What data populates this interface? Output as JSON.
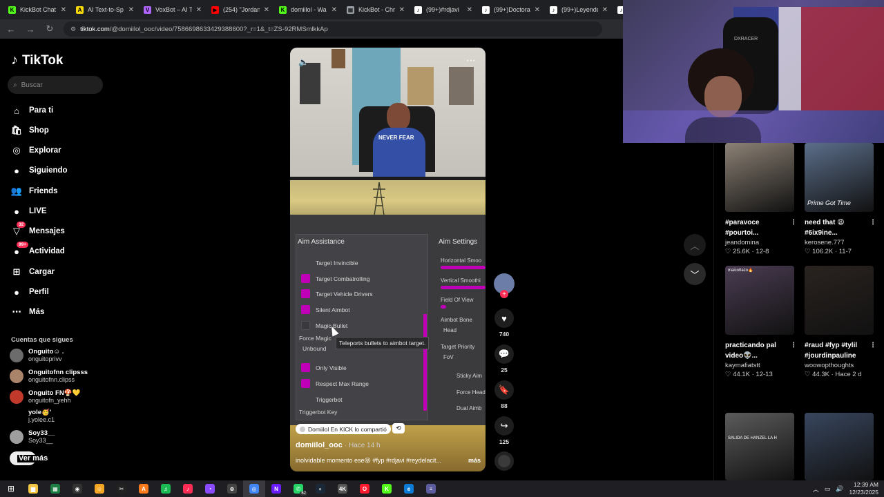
{
  "browser": {
    "tabs": [
      {
        "label": "KickBot Chat",
        "fav_color": "#53fc18",
        "fav_char": "K"
      },
      {
        "label": "AI Text-to-Sp",
        "fav_color": "#f5d90a",
        "fav_char": "A"
      },
      {
        "label": "VoxBot – AI T",
        "fav_color": "#b065ff",
        "fav_char": "V"
      },
      {
        "label": "(254) \"Jordan",
        "fav_color": "#ff0000",
        "fav_char": "▶"
      },
      {
        "label": "domiilol - Wa",
        "fav_color": "#53fc18",
        "fav_char": "K"
      },
      {
        "label": "KickBot - Chr",
        "fav_color": "#9aa0a6",
        "fav_char": "▦"
      },
      {
        "label": "(99+)#rdjavi",
        "fav_color": "#ffffff",
        "fav_char": "♪"
      },
      {
        "label": "(99+)Doctora",
        "fav_color": "#ffffff",
        "fav_char": "♪"
      },
      {
        "label": "(99+)Leyende",
        "fav_color": "#ffffff",
        "fav_char": "♪"
      },
      {
        "label": "(9",
        "fav_color": "#ffffff",
        "fav_char": "♪"
      }
    ],
    "url_domain": "tiktok.com",
    "url_path": "/@domiilol_ooc/video/7586698633429388600?_r=1&_t=ZS-92RMSmlkkAp"
  },
  "sidebar": {
    "logo": "TikTok",
    "search_placeholder": "Buscar",
    "nav": [
      {
        "label": "Para ti",
        "icon": "home-icon"
      },
      {
        "label": "Shop",
        "icon": "shop-icon"
      },
      {
        "label": "Explorar",
        "icon": "compass-icon"
      },
      {
        "label": "Siguiendo",
        "icon": "following-icon"
      },
      {
        "label": "Friends",
        "icon": "friends-icon"
      },
      {
        "label": "LIVE",
        "icon": "live-icon"
      },
      {
        "label": "Mensajes",
        "icon": "messages-icon",
        "badge": "32"
      },
      {
        "label": "Actividad",
        "icon": "activity-icon",
        "badge": "99+"
      },
      {
        "label": "Cargar",
        "icon": "upload-icon"
      },
      {
        "label": "Perfil",
        "icon": "profile-icon"
      },
      {
        "label": "Más",
        "icon": "more-icon"
      }
    ],
    "following_title": "Cuentas que sigues",
    "following": [
      {
        "name": "Onguito☺ .",
        "user": "onguitoprivv",
        "color": "#6c6c6c"
      },
      {
        "name": "Onguitofnn clipsss",
        "user": "onguitofnn.clipss",
        "color": "#a9846a"
      },
      {
        "name": "Onguito FN🍄💛",
        "user": "onguitofn_yehh",
        "color": "#c0392b"
      },
      {
        "name": "yole🥳'",
        "user": "j.yolee.c1",
        "color": "#000000"
      },
      {
        "name": "Soy33__",
        "user": "Soy33__",
        "color": "#9e9e9e"
      }
    ],
    "see_more": "Ver más"
  },
  "video": {
    "shirt_text": "NEVER FEAR",
    "menu": {
      "left_title": "Aim Assistance",
      "right_title": "Aim Settings",
      "options": [
        {
          "label": "Target Invincible",
          "checked": false,
          "hidden_box": true
        },
        {
          "label": "Target Combatrolling",
          "checked": true
        },
        {
          "label": "Target Vehicle Drivers",
          "checked": true
        },
        {
          "label": "Silent Aimbot",
          "checked": true
        },
        {
          "label": "Magic Bullet",
          "checked": false
        },
        {
          "label": "Only Visible",
          "checked": true
        },
        {
          "label": "Respect Max Range",
          "checked": true
        },
        {
          "label": "Triggerbot",
          "checked": false,
          "hidden_box": true
        }
      ],
      "force_magic": "Force Magic",
      "unbound": "Unbound",
      "triggerbot_key": "Triggerbot Key",
      "tooltip": "Teleports bullets to aimbot target.",
      "right_items": [
        "Horizontal Smoo",
        "Vertical Smoothi",
        "Field Of View",
        "Aimbot Bone",
        "Head",
        "Target Priority",
        "FoV",
        "Sticky Aim",
        "Force Head",
        "Dual Aimb"
      ]
    },
    "shared_label": "Domiilol En KICK lo compartió",
    "author": "domiilol_ooc",
    "posted": "· Hace 14 h",
    "caption": "inolvidable momento ese😝 #fyp #rdjavi #reydelacit...",
    "caption_more": "más"
  },
  "actions": [
    {
      "icon": "heart-icon",
      "count": "740"
    },
    {
      "icon": "comment-icon",
      "count": "25"
    },
    {
      "icon": "bookmark-icon",
      "count": "88"
    },
    {
      "icon": "share-icon",
      "count": "125"
    }
  ],
  "recommended": [
    {
      "title": "#paravoce #pourtoi...",
      "user": "jeandomina",
      "stats": "♡ 25.6K · 12-8",
      "bg": "#8c8175",
      "overlay": ""
    },
    {
      "title": "need that 😩 #6ix9ine...",
      "user": "kerosene.777",
      "stats": "♡ 106.2K · 11-7",
      "bg": "#5b6e8a",
      "overlay": "Prime Got Time"
    },
    {
      "title": "practicando pal video👽...",
      "user": "kaymafiatstt",
      "stats": "♡ 44.1K · 12-13",
      "bg": "#4a3c52",
      "overlay": "maicoñazo🔥"
    },
    {
      "title": "#raud #fyp #tylil #jourdinpauline",
      "user": "woowopthoughts",
      "stats": "♡ 44.3K · Hace 2 d",
      "bg": "#2a2320",
      "overlay": ""
    },
    {
      "title": "",
      "user": "",
      "stats": "",
      "bg": "#5b5b5b",
      "overlay": "SALIDA DE HANZEL LA H"
    },
    {
      "title": "",
      "user": "",
      "stats": "",
      "bg": "#38465e",
      "overlay": ""
    }
  ],
  "webcam": {
    "chair_brand": "DXRACER"
  },
  "taskbar": {
    "apps": [
      {
        "name": "file-explorer-icon",
        "color": "#f4c542",
        "char": "▆"
      },
      {
        "name": "spreadsheet-icon",
        "color": "#1e7e45",
        "char": "▦"
      },
      {
        "name": "obs-icon",
        "color": "#333333",
        "char": "◉"
      },
      {
        "name": "chat-icon",
        "color": "#f5a623",
        "char": "☺"
      },
      {
        "name": "capcut-icon",
        "color": "#222222",
        "char": "✂"
      },
      {
        "name": "streamlabs-icon",
        "color": "#ff7a1a",
        "char": "A"
      },
      {
        "name": "spotify-icon",
        "color": "#1db954",
        "char": "♫"
      },
      {
        "name": "tiktok-icon",
        "color": "#ff2d55",
        "char": "♪"
      },
      {
        "name": "messenger-icon",
        "color": "#8a4bff",
        "char": "◔"
      },
      {
        "name": "vpn-icon",
        "color": "#444444",
        "char": "⊕"
      },
      {
        "name": "chrome-icon",
        "color": "#4285f4",
        "char": "◎"
      },
      {
        "name": "next-icon",
        "color": "#6a1bff",
        "char": "N"
      },
      {
        "name": "whatsapp-icon",
        "color": "#25d366",
        "char": "✆",
        "badge": "62"
      },
      {
        "name": "steam-icon",
        "color": "#1b2838",
        "char": "◐"
      },
      {
        "name": "4k-icon",
        "color": "#555555",
        "char": "4K"
      },
      {
        "name": "opera-icon",
        "color": "#ff1b2d",
        "char": "O"
      },
      {
        "name": "kick-icon",
        "color": "#53fc18",
        "char": "K"
      },
      {
        "name": "edge-icon",
        "color": "#0c7bd6",
        "char": "e"
      },
      {
        "name": "app-icon",
        "color": "#5c5c9c",
        "char": "≡"
      }
    ],
    "time": "12:39 AM",
    "date": "12/23/2025"
  }
}
